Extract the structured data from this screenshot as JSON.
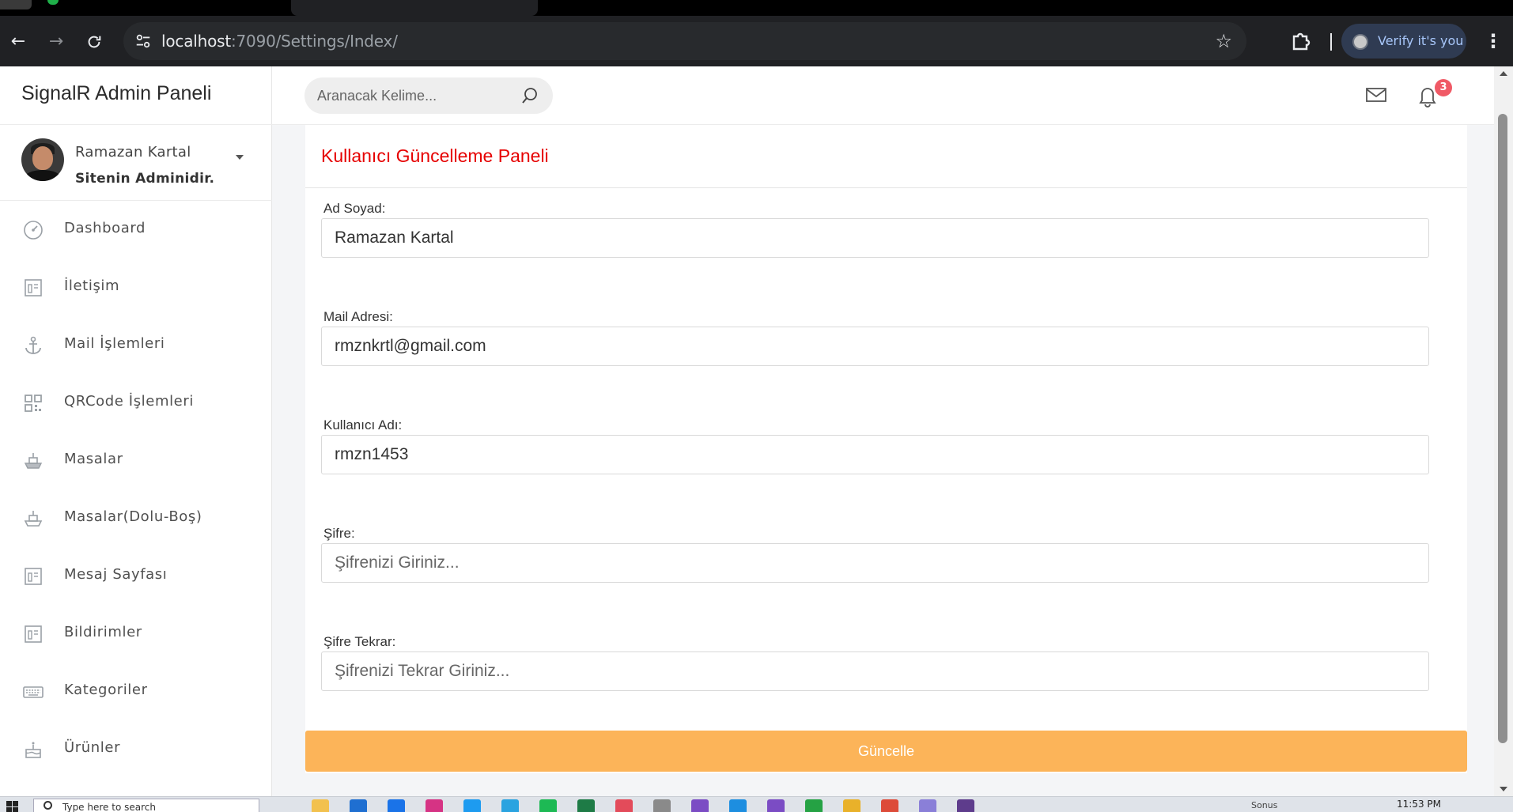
{
  "browser": {
    "url_host": "localhost",
    "url_path": ":7090/Settings/Index/",
    "profile_label": "Verify it's you"
  },
  "sidebar": {
    "brand": "SignalR Admin Paneli",
    "user": {
      "name": "Ramazan Kartal",
      "role": "Sitenin Adminidir."
    },
    "items": [
      {
        "label": "Dashboard",
        "icon": "speedometer-icon"
      },
      {
        "label": "İletişim",
        "icon": "contact-card-icon"
      },
      {
        "label": "Mail İşlemleri",
        "icon": "anchor-icon"
      },
      {
        "label": "QRCode İşlemleri",
        "icon": "qrcode-icon"
      },
      {
        "label": "Masalar",
        "icon": "ship-icon"
      },
      {
        "label": "Masalar(Dolu-Boş)",
        "icon": "ship-outline-icon"
      },
      {
        "label": "Mesaj Sayfası",
        "icon": "contact-card-icon"
      },
      {
        "label": "Bildirimler",
        "icon": "contact-card-icon"
      },
      {
        "label": "Kategoriler",
        "icon": "keyboard-icon"
      },
      {
        "label": "Ürünler",
        "icon": "cake-icon"
      }
    ]
  },
  "topbar": {
    "search_placeholder": "Aranacak Kelime...",
    "notification_count": "3"
  },
  "form": {
    "title": "Kullanıcı Güncelleme Paneli",
    "fields": [
      {
        "label": "Ad Soyad:",
        "value": "Ramazan Kartal",
        "placeholder": ""
      },
      {
        "label": "Mail Adresi:",
        "value": "rmznkrtl@gmail.com",
        "placeholder": ""
      },
      {
        "label": "Kullanıcı Adı:",
        "value": "rmzn1453",
        "placeholder": ""
      },
      {
        "label": "Şifre:",
        "value": "",
        "placeholder": "Şifrenizi Giriniz..."
      },
      {
        "label": "Şifre Tekrar:",
        "value": "",
        "placeholder": "Şifrenizi Tekrar Giriniz..."
      }
    ],
    "submit_label": "Güncelle"
  },
  "taskbar": {
    "search_text": "Type here to search",
    "time": "11:53 PM",
    "tray_text": "Sonus"
  },
  "colors": {
    "title_red": "#e60000",
    "submit_orange": "#fcb459",
    "badge_red": "#f05a66"
  }
}
